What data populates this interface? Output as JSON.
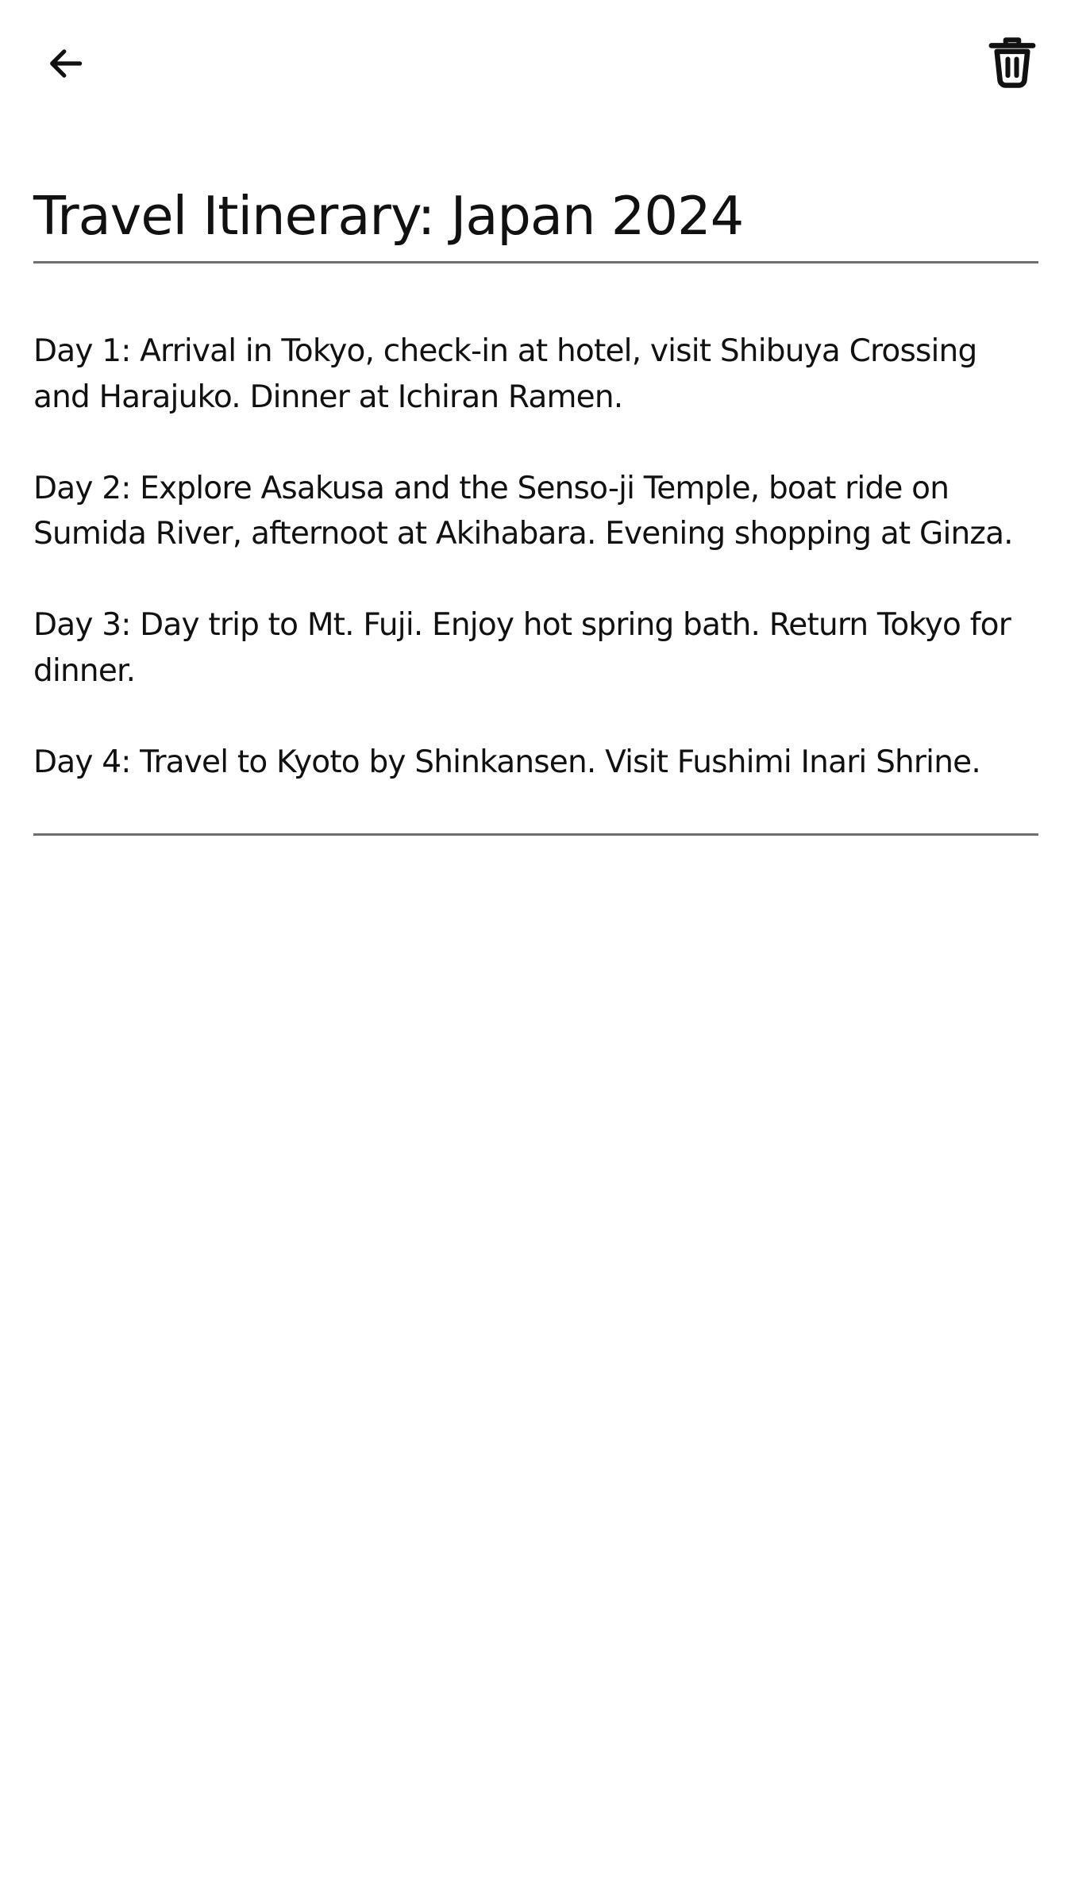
{
  "toolbar": {
    "back_icon": "arrow-left-icon",
    "delete_icon": "trash-icon"
  },
  "note": {
    "title": "Travel Itinerary: Japan 2024",
    "paragraphs": [
      "Day 1: Arrival in Tokyo, check-in at hotel, visit Shibuya Crossing and Harajuko. Dinner at Ichiran Ramen.",
      "Day 2: Explore Asakusa and the Senso-ji Temple, boat ride on Sumida River, afternoot at Akihabara. Evening shopping at Ginza.",
      "Day 3: Day trip to Mt. Fuji. Enjoy hot spring bath. Return Tokyo for dinner.",
      "Day 4: Travel to Kyoto by Shinkansen. Visit Fushimi Inari Shrine."
    ]
  },
  "colors": {
    "background": "#ffffff",
    "text": "#111111",
    "underline": "#6e6e6e"
  }
}
